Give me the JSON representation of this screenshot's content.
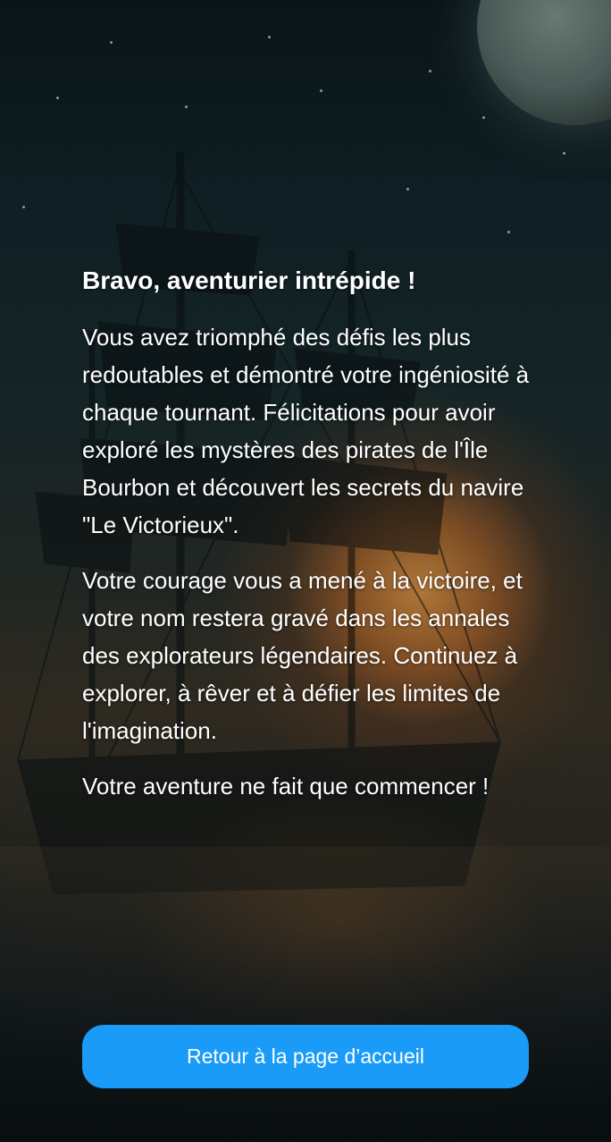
{
  "title": "Bravo, aventurier intrépide !",
  "paragraphs": [
    "Vous avez triomphé des défis les plus redoutables et démontré votre ingéniosité à chaque tournant. Félicitations pour avoir exploré les mystères des pirates de l'Île Bourbon et découvert les secrets du navire \"Le Victorieux\".",
    "Votre courage vous a mené à la victoire, et votre nom restera gravé dans les annales des explorateurs légendaires. Continuez à explorer, à rêver et à défier les limites de l'imagination.",
    "Votre aventure ne fait que commencer !"
  ],
  "button": {
    "label": "Retour à la page d’accueil",
    "color": "#1a9bf7"
  },
  "background": {
    "image": "pirate-ship-at-night-illustration"
  }
}
